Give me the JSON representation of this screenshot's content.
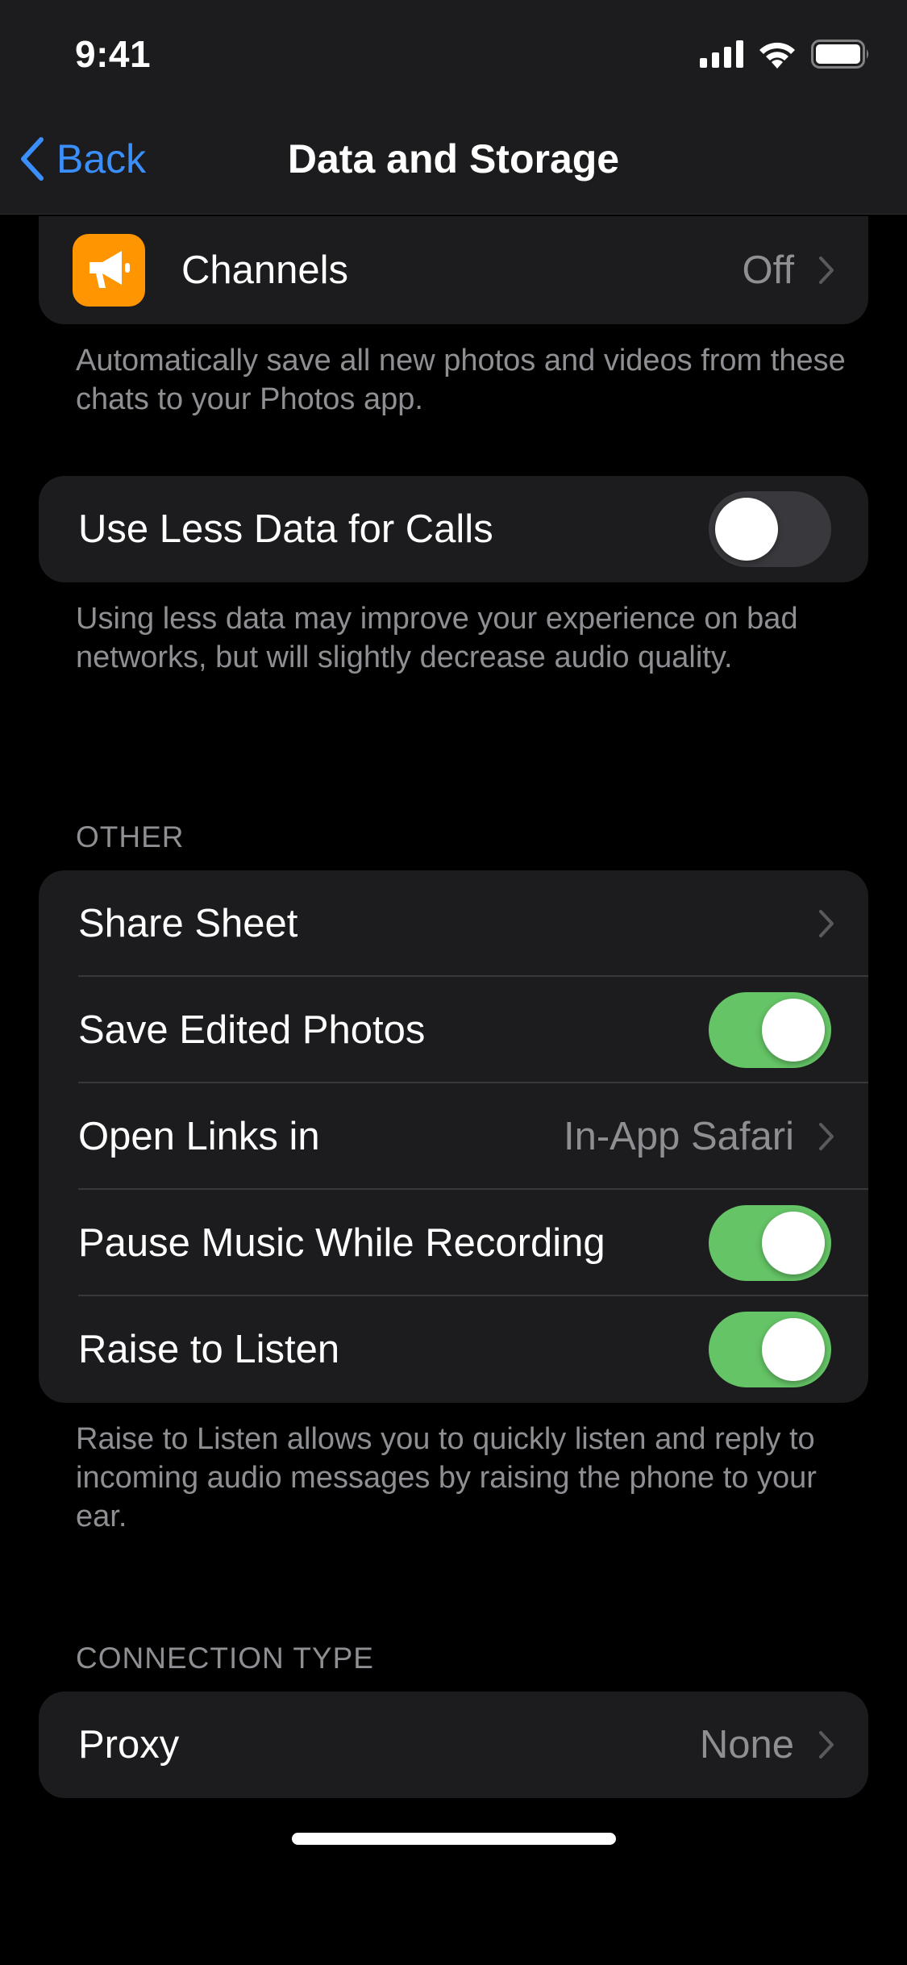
{
  "status_bar": {
    "time": "9:41"
  },
  "nav": {
    "back_label": "Back",
    "title": "Data and Storage"
  },
  "auto_save": {
    "channels_label": "Channels",
    "channels_value": "Off",
    "footer": "Automatically save all new photos and videos from these chats to your Photos app."
  },
  "calls": {
    "less_data_label": "Use Less Data for Calls",
    "less_data_enabled": false,
    "footer": "Using less data may improve your experience on bad networks, but will slightly decrease audio quality."
  },
  "other": {
    "header": "OTHER",
    "share_sheet_label": "Share Sheet",
    "save_edited_label": "Save Edited Photos",
    "save_edited_enabled": true,
    "open_links_label": "Open Links in",
    "open_links_value": "In-App Safari",
    "pause_music_label": "Pause Music While Recording",
    "pause_music_enabled": true,
    "raise_listen_label": "Raise to Listen",
    "raise_listen_enabled": true,
    "footer": "Raise to Listen allows you to quickly listen and reply to incoming audio messages by raising the phone to your ear."
  },
  "connection": {
    "header": "CONNECTION TYPE",
    "proxy_label": "Proxy",
    "proxy_value": "None"
  },
  "colors": {
    "accent": "#3a8ffa",
    "toggle_on": "#65c466",
    "channel_icon": "#ff9500"
  }
}
